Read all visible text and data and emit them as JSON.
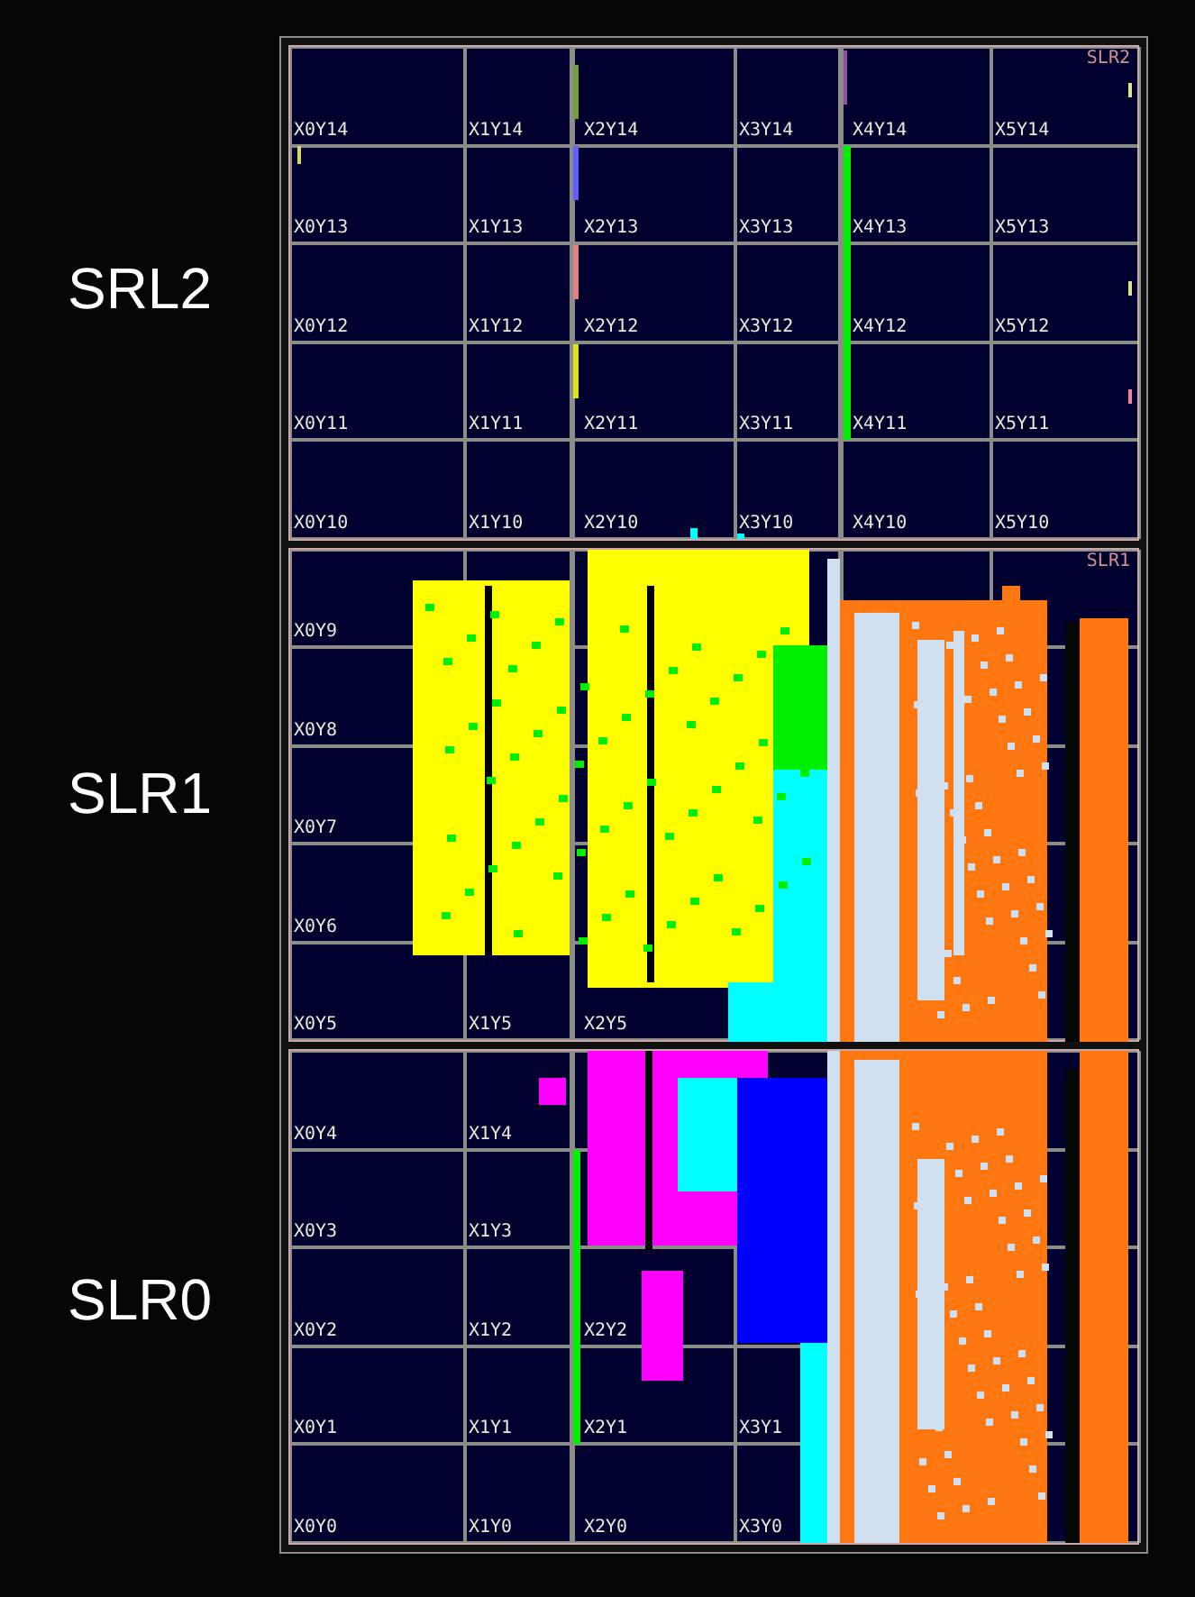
{
  "side_labels": [
    "SRL2",
    "SLR1",
    "SLR0"
  ],
  "slrs": [
    {
      "name": "SLR2",
      "rows": [
        [
          "X0Y14",
          "X1Y14",
          "X2Y14",
          "X3Y14",
          "X4Y14",
          "X5Y14"
        ],
        [
          "X0Y13",
          "X1Y13",
          "X2Y13",
          "X3Y13",
          "X4Y13",
          "X5Y13"
        ],
        [
          "X0Y12",
          "X1Y12",
          "X2Y12",
          "X3Y12",
          "X4Y12",
          "X5Y12"
        ],
        [
          "X0Y11",
          "X1Y11",
          "X2Y11",
          "X3Y11",
          "X4Y11",
          "X5Y11"
        ],
        [
          "X0Y10",
          "X1Y10",
          "X2Y10",
          "X3Y10",
          "X4Y10",
          "X5Y10"
        ]
      ]
    },
    {
      "name": "SLR1",
      "rows": [
        [
          "X0Y9",
          null,
          null,
          null,
          null,
          null
        ],
        [
          "X0Y8",
          null,
          null,
          null,
          null,
          null
        ],
        [
          "X0Y7",
          null,
          null,
          null,
          null,
          null
        ],
        [
          "X0Y6",
          null,
          null,
          null,
          null,
          null
        ],
        [
          "X0Y5",
          "X1Y5",
          "X2Y5",
          null,
          null,
          null
        ]
      ]
    },
    {
      "rows": [
        [
          "X0Y4",
          "X1Y4",
          null,
          null,
          null,
          null
        ],
        [
          "X0Y3",
          "X1Y3",
          null,
          null,
          null,
          null
        ],
        [
          "X0Y2",
          "X1Y2",
          "X2Y2",
          null,
          null,
          null
        ],
        [
          "X0Y1",
          "X1Y1",
          "X2Y1",
          "X3Y1",
          null,
          null
        ],
        [
          "X0Y0",
          "X1Y0",
          "X2Y0",
          "X3Y0",
          null,
          null
        ]
      ]
    }
  ]
}
